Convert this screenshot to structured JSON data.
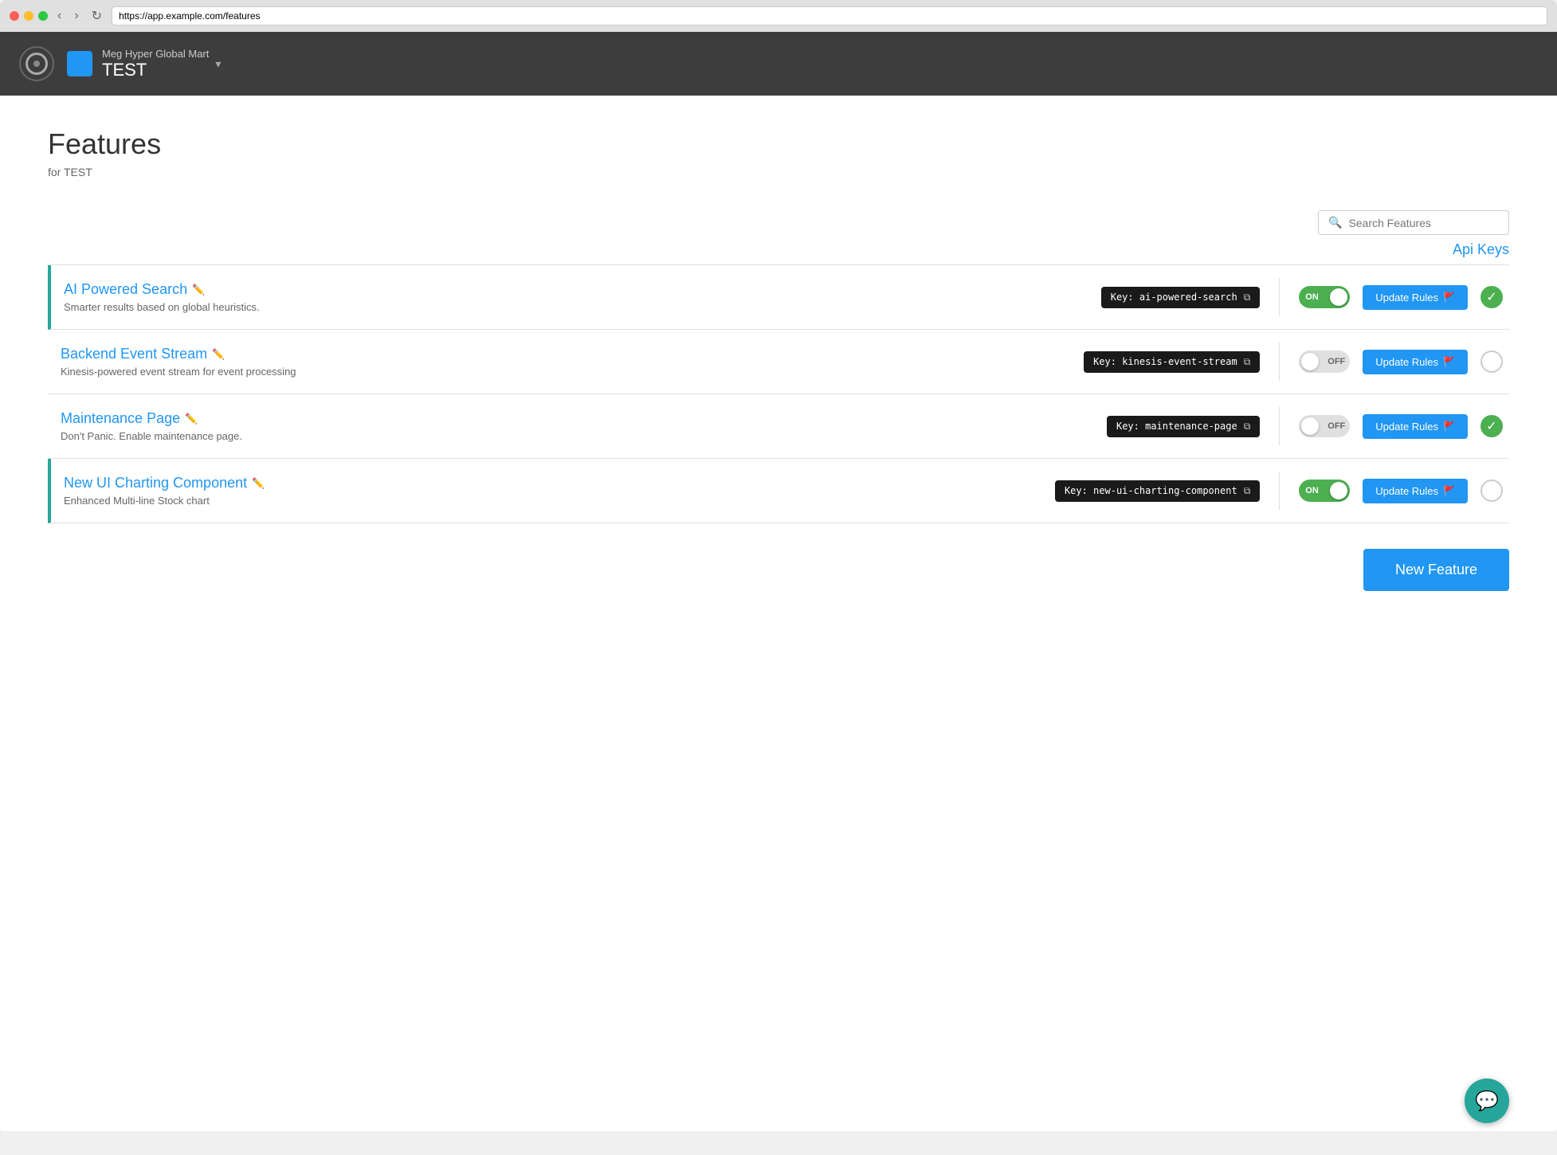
{
  "browser": {
    "address": "https://app.example.com/features"
  },
  "header": {
    "org_name": "Meg Hyper Global Mart",
    "env": "TEST",
    "dropdown_label": "TEST"
  },
  "page": {
    "title": "Features",
    "subtitle": "for TEST"
  },
  "search": {
    "placeholder": "Search Features"
  },
  "api_keys_label": "Api Keys",
  "features": [
    {
      "name": "AI Powered Search",
      "description": "Smarter results based on global heuristics.",
      "key": "Key: ai-powered-search",
      "toggle_state": "ON",
      "toggle_on": true,
      "active_left": true,
      "check_state": "filled",
      "update_rules_label": "Update Rules"
    },
    {
      "name": "Backend Event Stream",
      "description": "Kinesis-powered event stream for event processing",
      "key": "Key: kinesis-event-stream",
      "toggle_state": "OFF",
      "toggle_on": false,
      "active_left": false,
      "check_state": "empty",
      "update_rules_label": "Update Rules"
    },
    {
      "name": "Maintenance Page",
      "description": "Don't Panic. Enable maintenance page.",
      "key": "Key: maintenance-page",
      "toggle_state": "OFF",
      "toggle_on": false,
      "active_left": false,
      "check_state": "filled",
      "update_rules_label": "Update Rules"
    },
    {
      "name": "New UI Charting Component",
      "description": "Enhanced Multi-line Stock chart",
      "key": "Key: new-ui-charting-component",
      "toggle_state": "ON",
      "toggle_on": true,
      "active_left": true,
      "check_state": "empty",
      "update_rules_label": "Update Rules"
    }
  ],
  "new_feature_label": "New Feature",
  "chat_icon": "💬"
}
